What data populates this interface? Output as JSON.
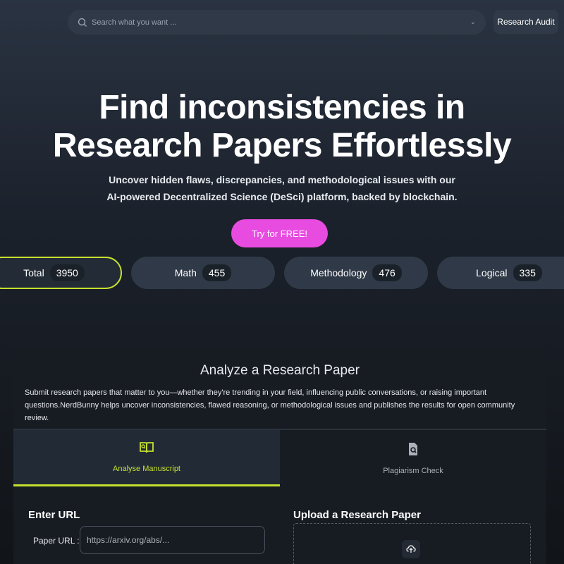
{
  "search": {
    "placeholder": "Search what you want ..."
  },
  "header": {
    "audit_label": "Research Audit"
  },
  "hero": {
    "title_line1": "Find inconsistencies in",
    "title_line2": "Research Papers Effortlessly",
    "subtitle": "Uncover hidden flaws, discrepancies, and methodological issues with our AI-powered Decentralized Science (DeSci) platform, backed by blockchain.",
    "cta_label": "Try for FREE!"
  },
  "stats": [
    {
      "label": "Total",
      "count": "3950"
    },
    {
      "label": "Math",
      "count": "455"
    },
    {
      "label": "Methodology",
      "count": "476"
    },
    {
      "label": "Logical",
      "count": "335"
    }
  ],
  "analyze": {
    "title": "Analyze a Research Paper",
    "description": "Submit research papers that matter to you—whether they're trending in your field, influencing public conversations, or raising important questions.NerdBunny helps uncover inconsistencies, flawed reasoning, or methodological issues and publishes the results for open community review.",
    "tabs": [
      {
        "label": "Analyse Manuscript"
      },
      {
        "label": "Plagiarism Check"
      }
    ],
    "url_heading": "Enter URL",
    "url_label": "Paper URL :",
    "url_placeholder": "https://arxiv.org/abs/...",
    "upload_heading": "Upload a Research Paper"
  },
  "colors": {
    "accent": "#c6e12e",
    "cta": "#e84be0"
  },
  "icons": [
    "search-icon",
    "chevron-down-icon",
    "book-icon",
    "file-search-icon",
    "cloud-upload-icon"
  ]
}
